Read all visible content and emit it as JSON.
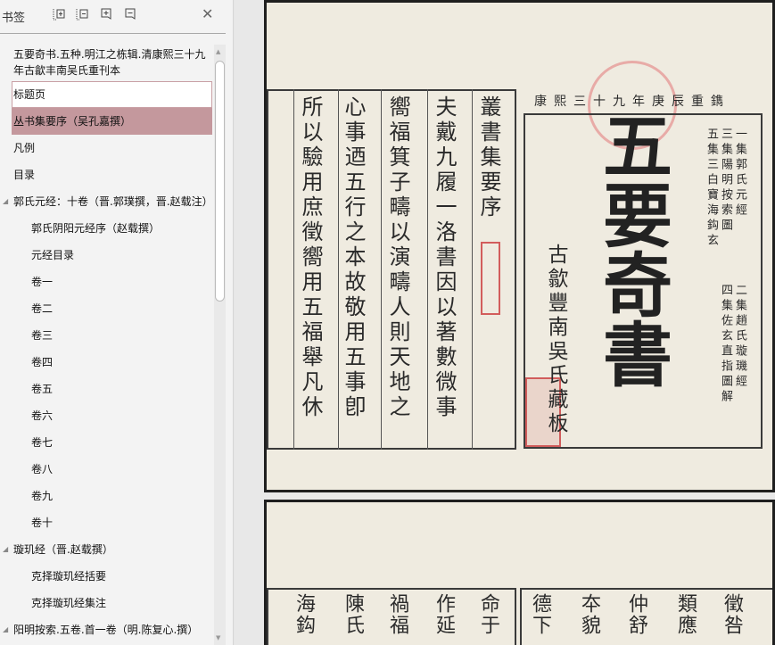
{
  "sidebar": {
    "title": "书签",
    "toolbar": {
      "expand": "expand-all",
      "collapse": "collapse-all",
      "add": "add-bookmark",
      "delete": "delete-bookmark"
    },
    "items": [
      {
        "label": "五要奇书.五种.明江之栋辑.清康熙三十九年古歙丰南吴氏重刊本",
        "level": 0
      },
      {
        "label": "标题页",
        "level": 0
      },
      {
        "label": "丛书集要序（吴孔嘉撰）",
        "level": 0
      },
      {
        "label": "凡例",
        "level": 0
      },
      {
        "label": "目录",
        "level": 0
      },
      {
        "label": "郭氏元经：十卷（晋.郭璞撰，晋.赵载注）",
        "level": 0
      },
      {
        "label": "郭氏阴阳元经序（赵载撰）",
        "level": 1
      },
      {
        "label": "元经目录",
        "level": 1
      },
      {
        "label": "卷一",
        "level": 1
      },
      {
        "label": "卷二",
        "level": 1
      },
      {
        "label": "卷三",
        "level": 1
      },
      {
        "label": "卷四",
        "level": 1
      },
      {
        "label": "卷五",
        "level": 1
      },
      {
        "label": "卷六",
        "level": 1
      },
      {
        "label": "卷七",
        "level": 1
      },
      {
        "label": "卷八",
        "level": 1
      },
      {
        "label": "卷九",
        "level": 1
      },
      {
        "label": "卷十",
        "level": 1
      },
      {
        "label": "璇玑经（晋.赵载撰）",
        "level": 0
      },
      {
        "label": "克择璇玑经括要",
        "level": 1
      },
      {
        "label": "克择璇玑经集注",
        "level": 1
      },
      {
        "label": "阳明按索.五卷.首一卷（明.陈复心.撰）",
        "level": 0
      }
    ]
  },
  "page1": {
    "left_cols": [
      "叢書集要序",
      "夫戴九履一洛書因以著數微事",
      "嚮福箕子疇以演疇人則天地之",
      "心事迺五行之本故敬用五事卽",
      "所以驗用庶徵嚮用五福舉凡休"
    ],
    "top_line": "康熙三十九年庚辰重鐫",
    "main_title": "五要奇書",
    "publisher": "古歙豐南吳氏藏板",
    "contents": [
      "一集郭氏元經",
      "三集陽明按索圖",
      "五集三白寶海鈎玄",
      "二集趙氏璇璣經",
      "四集佐玄直指圖解"
    ]
  },
  "page2": {
    "left_cols": [
      "命于",
      "作延",
      "禍福",
      "陳氏",
      "海鈎"
    ],
    "right_cols": [
      "德下",
      "夲貌",
      "仲舒",
      "類應",
      "徵咎"
    ]
  }
}
